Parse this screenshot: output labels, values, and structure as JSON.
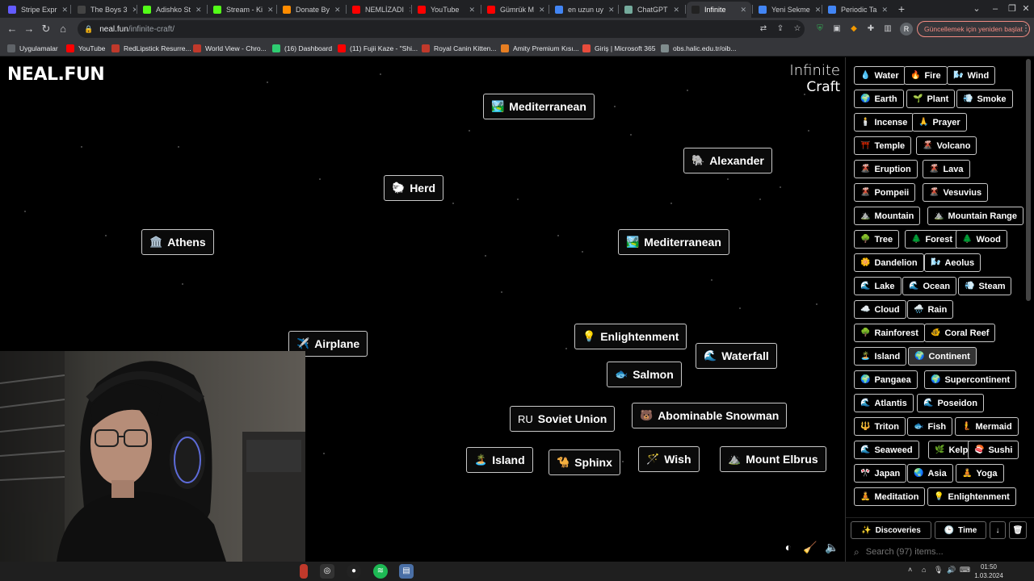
{
  "browser": {
    "tabs": [
      {
        "label": "Stripe Expr",
        "color": "#635bff",
        "icon": "stripe-icon"
      },
      {
        "label": "The Boys 3",
        "color": "#444",
        "icon": "tab-icon"
      },
      {
        "label": "Adishko St",
        "color": "#53fc18",
        "icon": "kick-icon"
      },
      {
        "label": "Stream - Ki",
        "color": "#53fc18",
        "icon": "kick-icon"
      },
      {
        "label": "Donate By",
        "color": "#ff8c00",
        "icon": "donate-icon"
      },
      {
        "label": "NEMLİZADI",
        "color": "#ff0000",
        "icon": "youtube-icon"
      },
      {
        "label": "YouTube",
        "color": "#ff0000",
        "icon": "youtube-icon"
      },
      {
        "label": "Gümrük M",
        "color": "#ff0000",
        "icon": "youtube-icon"
      },
      {
        "label": "en uzun uy",
        "color": "#4285f4",
        "icon": "google-icon"
      },
      {
        "label": "ChatGPT",
        "color": "#74aa9c",
        "icon": "chatgpt-icon"
      },
      {
        "label": "Infinite",
        "color": "#222",
        "icon": "infinite-craft-icon",
        "active": true
      },
      {
        "label": "Yeni Sekme",
        "color": "#4285f4",
        "icon": "chrome-icon"
      },
      {
        "label": "Periodic Ta",
        "color": "#4285f4",
        "icon": "google-icon"
      }
    ],
    "url_host": "neal.fun",
    "url_path": "/infinite-craft/",
    "update_label": "Güncellemek için yeniden başlat",
    "profile_initial": "R",
    "bookmarks": [
      {
        "label": "Uygulamalar",
        "color": "#5f6368",
        "icon": "apps-grid-icon"
      },
      {
        "label": "YouTube",
        "color": "#ff0000",
        "icon": "youtube-icon"
      },
      {
        "label": "RedLipstick Resurre...",
        "color": "#c0392b",
        "icon": "bookmark-icon"
      },
      {
        "label": "World View - Chro...",
        "color": "#c0392b",
        "icon": "bookmark-icon"
      },
      {
        "label": "(16) Dashboard",
        "color": "#2ecc71",
        "icon": "bookmark-icon"
      },
      {
        "label": "(11) Fujii Kaze - \"Shi...",
        "color": "#ff0000",
        "icon": "youtube-icon"
      },
      {
        "label": "Royal Canin Kitten...",
        "color": "#c0392b",
        "icon": "bookmark-icon"
      },
      {
        "label": "Amity Premium Kısı...",
        "color": "#e67e22",
        "icon": "bookmark-icon"
      },
      {
        "label": "Giriş | Microsoft 365",
        "color": "#e74c3c",
        "icon": "microsoft-icon"
      },
      {
        "label": "obs.halic.edu.tr/oib...",
        "color": "#7f8c8d",
        "icon": "globe-icon"
      }
    ]
  },
  "canvas": {
    "logo": "NEAL.FUN",
    "brand_line1": "Infinite",
    "brand_line2": "Craft",
    "elements": [
      {
        "emoji": "🏞️",
        "label": "Mediterranean"
      },
      {
        "emoji": "🐘",
        "label": "Alexander"
      },
      {
        "emoji": "🐑",
        "label": "Herd"
      },
      {
        "emoji": "🏛️",
        "label": "Athens"
      },
      {
        "emoji": "🏞️",
        "label": "Mediterranean"
      },
      {
        "emoji": "✈️",
        "label": "Airplane"
      },
      {
        "emoji": "💡",
        "label": "Enlightenment"
      },
      {
        "emoji": "🌊",
        "label": "Waterfall"
      },
      {
        "emoji": "🐟",
        "label": "Salmon"
      },
      {
        "emoji": "RU",
        "label": "Soviet Union"
      },
      {
        "emoji": "🐻",
        "label": "Abominable Snowman"
      },
      {
        "emoji": "🏝️",
        "label": "Island"
      },
      {
        "emoji": "🐪",
        "label": "Sphinx"
      },
      {
        "emoji": "🪄",
        "label": "Wish"
      },
      {
        "emoji": "⛰️",
        "label": "Mount Elbrus"
      }
    ]
  },
  "sidebar": {
    "items": [
      {
        "emoji": "💧",
        "label": "Water"
      },
      {
        "emoji": "🔥",
        "label": "Fire"
      },
      {
        "emoji": "🌬️",
        "label": "Wind"
      },
      {
        "emoji": "🌍",
        "label": "Earth"
      },
      {
        "emoji": "🌱",
        "label": "Plant"
      },
      {
        "emoji": "💨",
        "label": "Smoke"
      },
      {
        "emoji": "🕯️",
        "label": "Incense"
      },
      {
        "emoji": "🙏",
        "label": "Prayer"
      },
      {
        "emoji": "⛩️",
        "label": "Temple"
      },
      {
        "emoji": "🌋",
        "label": "Volcano"
      },
      {
        "emoji": "🌋",
        "label": "Eruption"
      },
      {
        "emoji": "🌋",
        "label": "Lava"
      },
      {
        "emoji": "🌋",
        "label": "Pompeii"
      },
      {
        "emoji": "🌋",
        "label": "Vesuvius"
      },
      {
        "emoji": "⛰️",
        "label": "Mountain"
      },
      {
        "emoji": "⛰️",
        "label": "Mountain Range"
      },
      {
        "emoji": "🌳",
        "label": "Tree"
      },
      {
        "emoji": "🌲",
        "label": "Forest"
      },
      {
        "emoji": "🌲",
        "label": "Wood"
      },
      {
        "emoji": "🌼",
        "label": "Dandelion"
      },
      {
        "emoji": "🌬️",
        "label": "Aeolus"
      },
      {
        "emoji": "🌊",
        "label": "Lake"
      },
      {
        "emoji": "🌊",
        "label": "Ocean"
      },
      {
        "emoji": "💨",
        "label": "Steam"
      },
      {
        "emoji": "☁️",
        "label": "Cloud"
      },
      {
        "emoji": "🌧️",
        "label": "Rain"
      },
      {
        "emoji": "🌳",
        "label": "Rainforest"
      },
      {
        "emoji": "🐠",
        "label": "Coral Reef"
      },
      {
        "emoji": "🏝️",
        "label": "Island"
      },
      {
        "emoji": "🌍",
        "label": "Continent"
      },
      {
        "emoji": "🌍",
        "label": "Pangaea"
      },
      {
        "emoji": "🌍",
        "label": "Supercontinent"
      },
      {
        "emoji": "🌊",
        "label": "Atlantis"
      },
      {
        "emoji": "🌊",
        "label": "Poseidon"
      },
      {
        "emoji": "🔱",
        "label": "Triton"
      },
      {
        "emoji": "🐟",
        "label": "Fish"
      },
      {
        "emoji": "🧜",
        "label": "Mermaid"
      },
      {
        "emoji": "🌊",
        "label": "Seaweed"
      },
      {
        "emoji": "🌿",
        "label": "Kelp"
      },
      {
        "emoji": "🍣",
        "label": "Sushi"
      },
      {
        "emoji": "🎌",
        "label": "Japan"
      },
      {
        "emoji": "🌏",
        "label": "Asia"
      },
      {
        "emoji": "🧘",
        "label": "Yoga"
      },
      {
        "emoji": "🧘",
        "label": "Meditation"
      },
      {
        "emoji": "💡",
        "label": "Enlightenment"
      }
    ],
    "discoveries_label": "Discoveries",
    "time_label": "Time",
    "search_placeholder": "Search (97) items..."
  },
  "taskbar": {
    "time": "01:50",
    "date": "1.03.2024"
  }
}
